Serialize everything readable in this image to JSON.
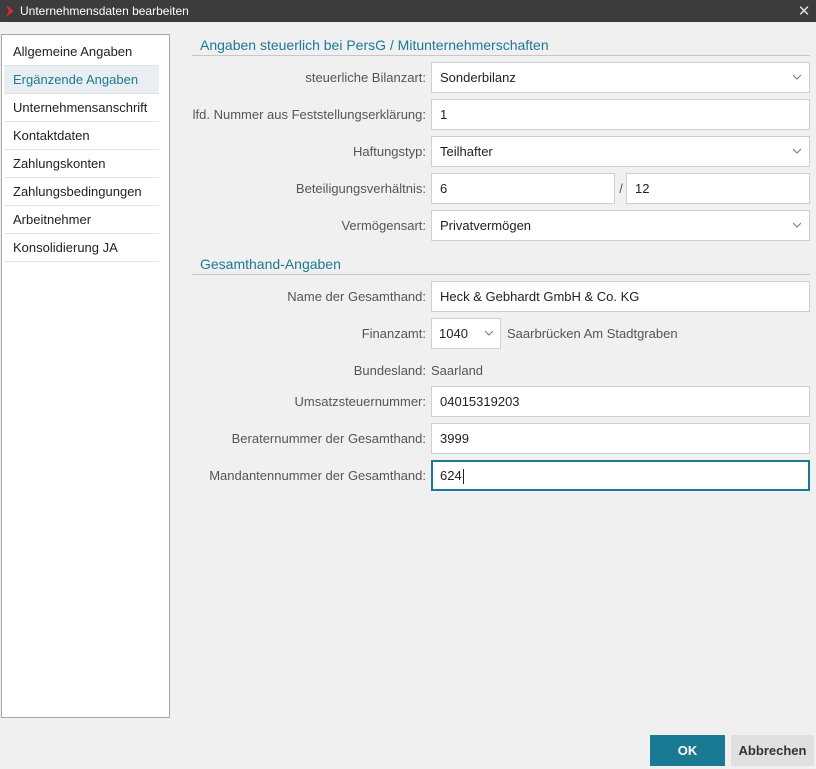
{
  "window": {
    "title": "Unternehmensdaten bearbeiten",
    "close_glyph": "✕"
  },
  "sidebar": {
    "items": [
      {
        "label": "Allgemeine Angaben"
      },
      {
        "label": "Ergänzende Angaben"
      },
      {
        "label": "Unternehmensanschrift"
      },
      {
        "label": "Kontaktdaten"
      },
      {
        "label": "Zahlungskonten"
      },
      {
        "label": "Zahlungsbedingungen"
      },
      {
        "label": "Arbeitnehmer"
      },
      {
        "label": "Konsolidierung JA"
      }
    ],
    "active_index": 1
  },
  "section1": {
    "header": "Angaben steuerlich bei PersG / Mitunternehmerschaften",
    "bilanzart": {
      "label": "steuerliche Bilanzart:",
      "value": "Sonderbilanz"
    },
    "lfd_nummer": {
      "label": "lfd. Nummer aus Feststellungserklärung:",
      "value": "1"
    },
    "haftungstyp": {
      "label": "Haftungstyp:",
      "value": "Teilhafter"
    },
    "beteiligung": {
      "label": "Beteiligungsverhältnis:",
      "numerator": "6",
      "separator": "/",
      "denominator": "12"
    },
    "vermoegensart": {
      "label": "Vermögensart:",
      "value": "Privatvermögen"
    }
  },
  "section2": {
    "header": "Gesamthand-Angaben",
    "name": {
      "label": "Name der Gesamthand:",
      "value": "Heck & Gebhardt GmbH & Co. KG"
    },
    "finanzamt": {
      "label": "Finanzamt:",
      "code": "1040",
      "name": "Saarbrücken Am Stadtgraben"
    },
    "bundesland": {
      "label": "Bundesland:",
      "value": "Saarland"
    },
    "ust_nummer": {
      "label": "Umsatzsteuernummer:",
      "value": "04015319203"
    },
    "berater": {
      "label": "Beraternummer der Gesamthand:",
      "value": "3999"
    },
    "mandant": {
      "label": "Mandantennummer der Gesamthand:",
      "value": "624"
    }
  },
  "buttons": {
    "ok": "OK",
    "cancel": "Abbrechen"
  },
  "colors": {
    "accent": "#1a7a96",
    "titlebar": "#3c3c3c",
    "logo": "#d32f2f"
  }
}
